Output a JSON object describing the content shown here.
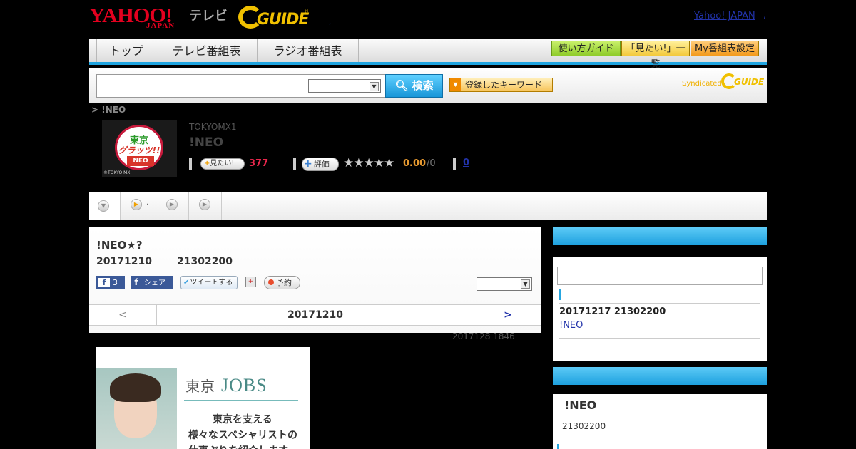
{
  "header": {
    "yahoo_logo_top": "YAHOO!",
    "yahoo_logo_bottom": "JAPAN",
    "tv_label": "テレビ",
    "gguide_logo": "GUIDE",
    "yahoo_japan_link": "Yahoo! JAPAN",
    "separator": ","
  },
  "nav": {
    "tabs": [
      "トップ",
      "テレビ番組表",
      "ラジオ番組表"
    ],
    "right_buttons": [
      "使い方ガイド",
      "「見たい!」一覧",
      "My番組表設定"
    ]
  },
  "search": {
    "input_value": "",
    "select_value": "",
    "button_label": "検索",
    "keyword_button": "登録したキーワード",
    "syndicated_label": "Syndicated",
    "syndicated_logo": "GUIDE"
  },
  "breadcrumb": "> !NEO",
  "program": {
    "thumbnail": {
      "line1": "東京",
      "line2": "グラッツ!!",
      "line3": "NEO",
      "copyright": "©TOKYO MX"
    },
    "channel": "TOKYOMX1",
    "title": "!NEO",
    "mitai_label": "見たい!",
    "mitai_count": "377",
    "eval_label": "評価",
    "stars": "★★★★★",
    "rating": "0.00",
    "rating_count": "/0",
    "comments": "0"
  },
  "tabs": {
    "second_label": "."
  },
  "episode": {
    "title": "!NEO★?",
    "date": "20171210",
    "time": "21302200",
    "fb_count": "3",
    "fb_share": "シェア",
    "tweet": "ツイートする",
    "reserve": "予約",
    "select_value": "",
    "nav_prev": "<",
    "nav_date": "20171210",
    "nav_next": ">",
    "updated": "2017128  1846"
  },
  "ad": {
    "brand_prefix": "東京",
    "brand_name": "JOBS",
    "copy1": "東京を支える",
    "copy2": "様々なスペシャリストの",
    "copy3": "仕事ぶりを紹介します"
  },
  "sidebar": {
    "box1": {
      "date_time": "20171217  21302200",
      "link": "!NEO "
    },
    "box2": {
      "title": "!NEO",
      "time": "21302200"
    }
  }
}
